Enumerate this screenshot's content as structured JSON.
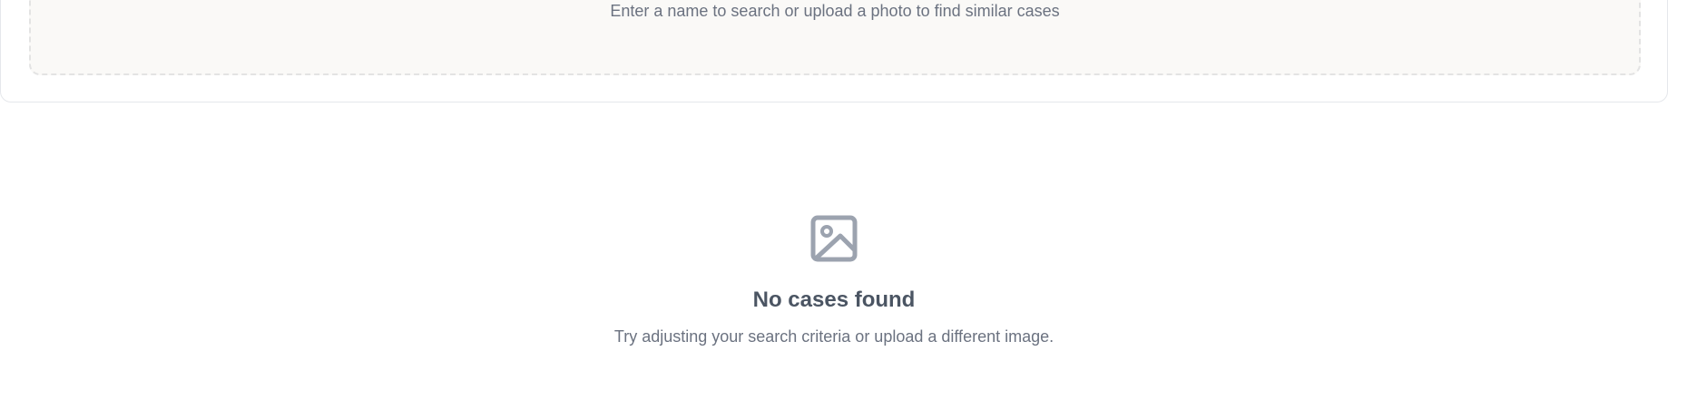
{
  "search": {
    "hint": "Enter a name to search or upload a photo to find similar cases"
  },
  "empty_state": {
    "icon": "image-icon",
    "title": "No cases found",
    "subtitle": "Try adjusting your search criteria or upload a different image."
  },
  "colors": {
    "icon": "#9ca3af",
    "title": "#4b5563",
    "text": "#6b7280",
    "drop_zone_bg": "#faf9f7"
  }
}
